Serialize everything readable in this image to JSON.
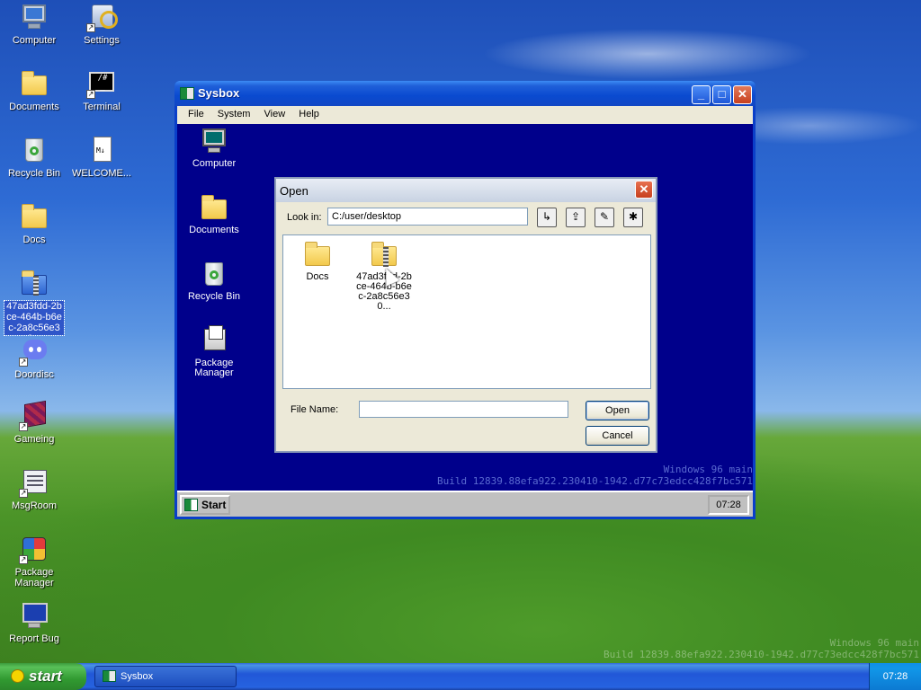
{
  "desktop": {
    "icons": [
      {
        "label": "Computer"
      },
      {
        "label": "Settings"
      },
      {
        "label": "Documents"
      },
      {
        "label": "Terminal"
      },
      {
        "label": "Recycle Bin"
      },
      {
        "label": "WELCOME..."
      },
      {
        "label": "Docs"
      },
      {
        "label": "47ad3fdd-2bce-464b-b6ec-2a8c56e30..."
      },
      {
        "label": "Doordisc"
      },
      {
        "label": "Gameing"
      },
      {
        "label": "MsgRoom"
      },
      {
        "label": "Package Manager"
      },
      {
        "label": "Report Bug"
      }
    ],
    "watermark_line1": "Windows 96 main",
    "watermark_line2": "Build 12839.88efa922.230410-1942.d77c73edcc428f7bc571"
  },
  "sysbox": {
    "title": "Sysbox",
    "menu": [
      "File",
      "System",
      "View",
      "Help"
    ],
    "inner_icons": [
      {
        "label": "Computer"
      },
      {
        "label": "Documents"
      },
      {
        "label": "Recycle Bin"
      },
      {
        "label": "Package Manager"
      }
    ],
    "watermark_line1": "Windows 96 main",
    "watermark_line2": "Build 12839.88efa922.230410-1942.d77c73edcc428f7bc571",
    "start_label": "Start",
    "clock": "07:28"
  },
  "open_dialog": {
    "title": "Open",
    "look_in_label": "Look in:",
    "look_in_value": "C:/user/desktop",
    "files": [
      {
        "label": "Docs"
      },
      {
        "label": "47ad3fdd-2bce-464b-b6ec-2a8c56e30..."
      }
    ],
    "file_name_label": "File Name:",
    "file_name_value": "",
    "open_label": "Open",
    "cancel_label": "Cancel"
  },
  "taskbar": {
    "start_label": "start",
    "task_label": "Sysbox",
    "clock": "07:28"
  }
}
